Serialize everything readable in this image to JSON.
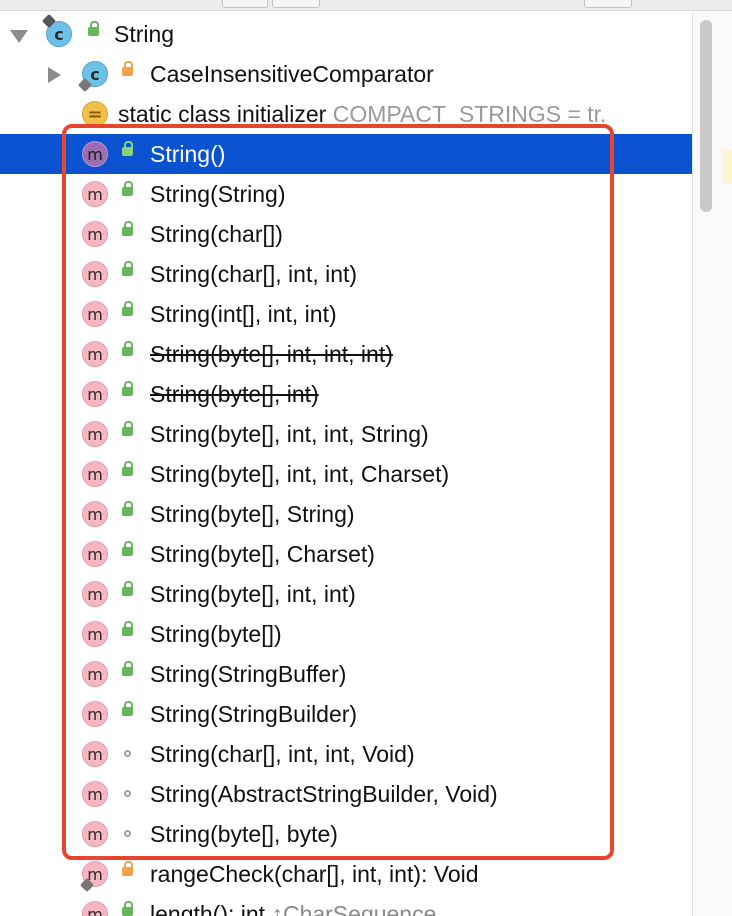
{
  "colors": {
    "selection": "#0b52d1",
    "highlight_box": "#e8452e",
    "method_icon": "#f7b7c2",
    "class_icon": "#6ec1e6",
    "public_lock": "#69b55b",
    "private_lock": "#f0a24b"
  },
  "tree": {
    "root": {
      "label": "String",
      "icon": "class-icon",
      "visibility": "public",
      "expanded": true
    },
    "nested_class": {
      "label": "CaseInsensitiveComparator",
      "icon": "class-icon",
      "visibility": "private",
      "expanded": false
    },
    "initializer": {
      "label": "static class initializer",
      "detail": "COMPACT_STRINGS = tr.",
      "icon": "initializer-icon"
    },
    "constructors": [
      {
        "label": "String()",
        "visibility": "public",
        "selected": true,
        "deprecated": false
      },
      {
        "label": "String(String)",
        "visibility": "public",
        "deprecated": false
      },
      {
        "label": "String(char[])",
        "visibility": "public",
        "deprecated": false
      },
      {
        "label": "String(char[], int, int)",
        "visibility": "public",
        "deprecated": false
      },
      {
        "label": "String(int[], int, int)",
        "visibility": "public",
        "deprecated": false
      },
      {
        "label": "String(byte[], int, int, int)",
        "visibility": "public",
        "deprecated": true
      },
      {
        "label": "String(byte[], int)",
        "visibility": "public",
        "deprecated": true
      },
      {
        "label": "String(byte[], int, int, String)",
        "visibility": "public",
        "deprecated": false
      },
      {
        "label": "String(byte[], int, int, Charset)",
        "visibility": "public",
        "deprecated": false
      },
      {
        "label": "String(byte[], String)",
        "visibility": "public",
        "deprecated": false
      },
      {
        "label": "String(byte[], Charset)",
        "visibility": "public",
        "deprecated": false
      },
      {
        "label": "String(byte[], int, int)",
        "visibility": "public",
        "deprecated": false
      },
      {
        "label": "String(byte[])",
        "visibility": "public",
        "deprecated": false
      },
      {
        "label": "String(StringBuffer)",
        "visibility": "public",
        "deprecated": false
      },
      {
        "label": "String(StringBuilder)",
        "visibility": "public",
        "deprecated": false
      },
      {
        "label": "String(char[], int, int, Void)",
        "visibility": "package-private",
        "deprecated": false
      },
      {
        "label": "String(AbstractStringBuilder, Void)",
        "visibility": "package-private",
        "deprecated": false
      },
      {
        "label": "String(byte[], byte)",
        "visibility": "package-private",
        "deprecated": false
      }
    ],
    "methods_after": [
      {
        "label": "rangeCheck(char[], int, int): Void",
        "visibility": "private",
        "static": true
      },
      {
        "label": "length(): int",
        "detail": "↑CharSequence",
        "visibility": "public"
      }
    ],
    "method_icon_letter": "m",
    "class_icon_letter": "c",
    "initializer_icon_letter": "="
  }
}
